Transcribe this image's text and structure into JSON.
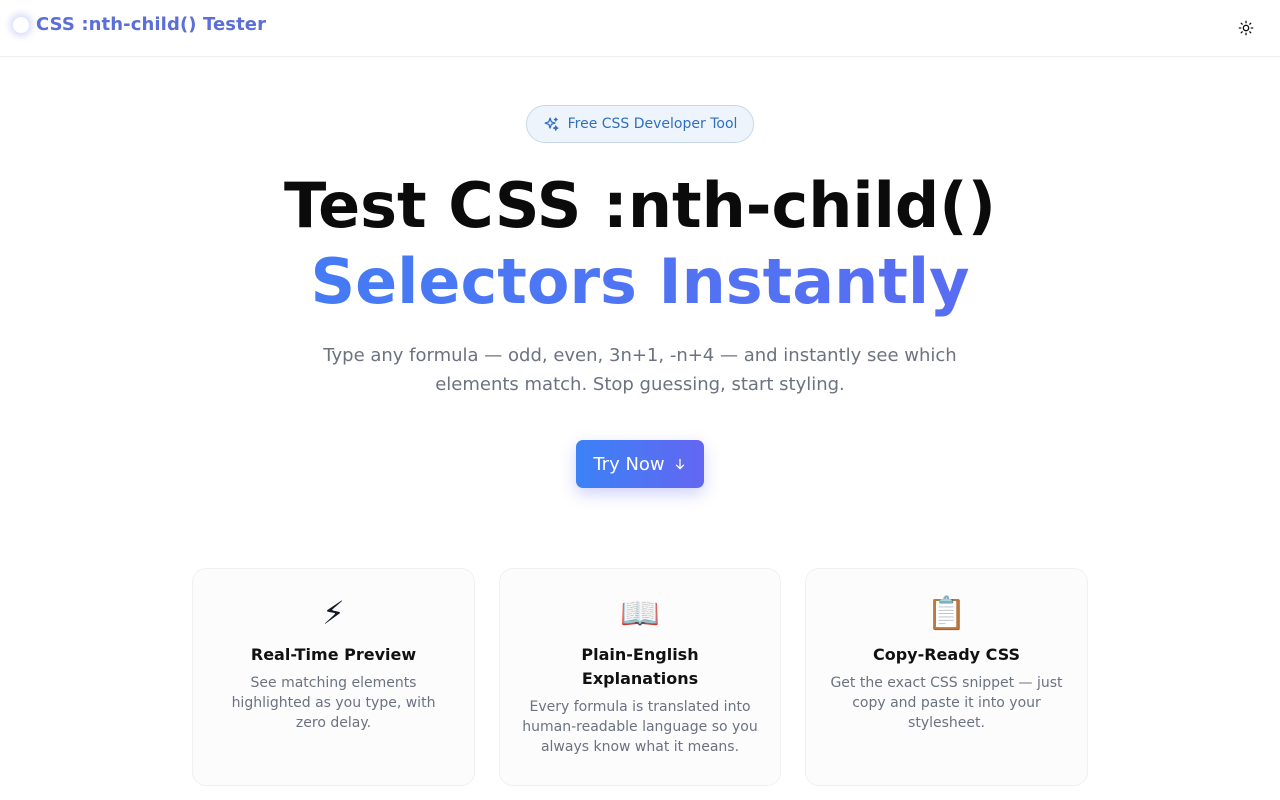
{
  "header": {
    "app_title": "CSS :nth-child() Tester",
    "logo_icon": "glow-dot",
    "theme_toggle_icon": "sun-icon"
  },
  "hero": {
    "badge_icon": "sparkles-icon",
    "badge_text": "Free CSS Developer Tool",
    "title_line1": "Test CSS :nth-child()",
    "title_line2": "Selectors Instantly",
    "subtitle": "Type any formula — odd, even, 3n+1, -n+4 — and instantly see which elements match. Stop guessing, start styling.",
    "cta_label": "Try Now",
    "cta_icon": "arrow-down-icon"
  },
  "features": [
    {
      "icon": "⚡",
      "icon_name": "lightning-icon",
      "title": "Real-Time Preview",
      "description": "See matching elements highlighted as you type, with zero delay."
    },
    {
      "icon": "📖",
      "icon_name": "open-book-icon",
      "title": "Plain-English Explanations",
      "description": "Every formula is translated into human-readable language so you always know what it means."
    },
    {
      "icon": "📋",
      "icon_name": "clipboard-icon",
      "title": "Copy-Ready CSS",
      "description": "Get the exact CSS snippet — just copy and paste it into your stylesheet."
    }
  ],
  "colors": {
    "accent_start": "#3b82f6",
    "accent_end": "#6366f1",
    "logo_text": "#5b6fd6",
    "badge_text": "#2f6fbe"
  }
}
